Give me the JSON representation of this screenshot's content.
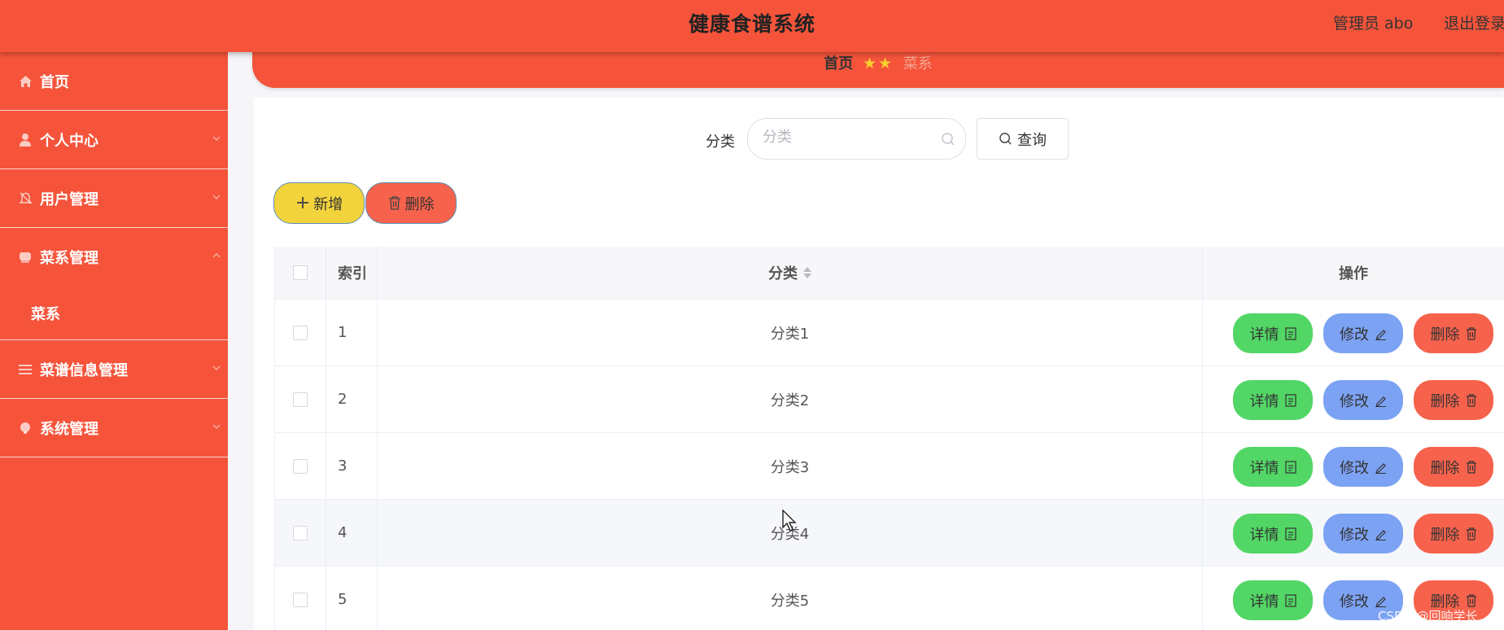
{
  "header": {
    "title": "健康食谱系统",
    "user_text": "管理员 abo",
    "logout": "退出登录"
  },
  "sidebar": {
    "items": [
      {
        "label": "首页",
        "icon": "home-icon"
      },
      {
        "label": "个人中心",
        "icon": "user-icon"
      },
      {
        "label": "用户管理",
        "icon": "bell-icon"
      },
      {
        "label": "菜系管理",
        "icon": "category-icon",
        "expanded": true,
        "children": [
          {
            "label": "菜系"
          }
        ]
      },
      {
        "label": "菜谱信息管理",
        "icon": "list-icon"
      },
      {
        "label": "系统管理",
        "icon": "settings-icon"
      }
    ]
  },
  "breadcrumb": {
    "home": "首页",
    "current": "菜系"
  },
  "search": {
    "label": "分类",
    "placeholder": "分类",
    "button": "查询"
  },
  "actions": {
    "add": "新增",
    "delete": "删除"
  },
  "table": {
    "columns": {
      "index": "索引",
      "category": "分类",
      "operation": "操作"
    },
    "row_buttons": {
      "detail": "详情",
      "edit": "修改",
      "delete": "删除"
    },
    "rows": [
      {
        "index": "1",
        "category": "分类1"
      },
      {
        "index": "2",
        "category": "分类2"
      },
      {
        "index": "3",
        "category": "分类3"
      },
      {
        "index": "4",
        "category": "分类4",
        "hovered": true
      },
      {
        "index": "5",
        "category": "分类5"
      }
    ]
  },
  "watermark": "CSDN @回响学长",
  "colors": {
    "primary": "#f5543b",
    "add": "#f3d33c",
    "detail": "#52d665",
    "edit": "#7ca2f4",
    "delete": "#f6624c"
  }
}
